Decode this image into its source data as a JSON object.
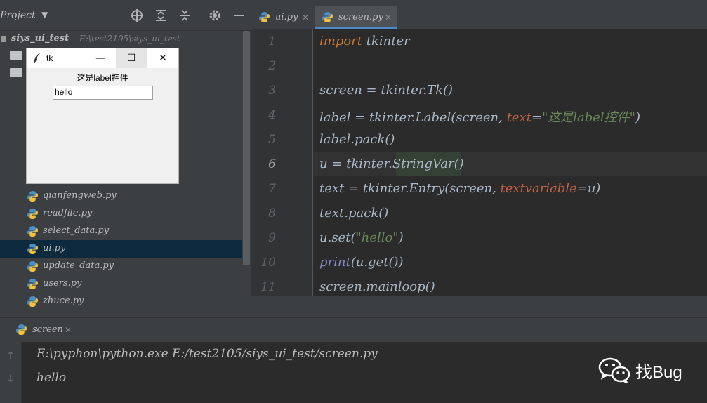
{
  "project_panel": {
    "title": "Project",
    "dropdown": "▼",
    "toolbar_icons": [
      "crosshair-icon",
      "expand-all-icon",
      "collapse-all-icon",
      "gear-icon",
      "minimize-icon"
    ],
    "root": {
      "name": "siys_ui_test",
      "path": "E:\\test2105\\siys_ui_test"
    },
    "files": [
      {
        "label": "qianfengweb.py",
        "selected": false
      },
      {
        "label": "readfile.py",
        "selected": false
      },
      {
        "label": "select_data.py",
        "selected": false
      },
      {
        "label": "ui.py",
        "selected": true
      },
      {
        "label": "update_data.py",
        "selected": false
      },
      {
        "label": "users.py",
        "selected": false
      },
      {
        "label": "zhuce.py",
        "selected": false
      }
    ]
  },
  "tk_window": {
    "title": "tk",
    "minimize": "—",
    "maximize": "☐",
    "close": "✕",
    "label_text": "这是label控件",
    "entry_value": "hello"
  },
  "editor": {
    "tabs": [
      {
        "label": "ui.py",
        "close": "✕",
        "active": false
      },
      {
        "label": "screen.py",
        "close": "✕",
        "active": true
      }
    ],
    "line_numbers": [
      "1",
      "2",
      "3",
      "4",
      "5",
      "6",
      "7",
      "8",
      "9",
      "10",
      "11"
    ],
    "current_line": "6",
    "code": {
      "l1_kw": "import",
      "l1_rest": " tkinter",
      "l3": "screen = tkinter.Tk()",
      "l4_a": "label = tkinter.Label(screen, ",
      "l4_param": "text",
      "l4_eq": "=",
      "l4_str": "\"这是label控件\"",
      "l4_end": ")",
      "l5": "label.pack()",
      "l6": "u = tkinter.StringVar()",
      "l7_a": "text = tkinter.Entry(screen, ",
      "l7_param": "textvariable",
      "l7_end": "=u)",
      "l8": "text.pack()",
      "l9_a": "u.set(",
      "l9_str": "\"hello\"",
      "l9_end": ")",
      "l10_builtin": "print",
      "l10_rest": "(u.get())",
      "l11": "screen.mainloop()"
    }
  },
  "run_panel": {
    "tab_label": "screen",
    "tab_close": "✕",
    "up_arrow": "↑",
    "down_arrow": "↓",
    "console": [
      "E:\\pyphon\\python.exe E:/test2105/siys_ui_test/screen.py",
      "hello"
    ]
  },
  "watermark": {
    "text": "找Bug",
    "icon": "wechat-icon"
  },
  "colors": {
    "keyword": "#cc7832",
    "string": "#6a8759",
    "param": "#c06040",
    "builtin": "#8888c6",
    "selection": "#0d293e",
    "tab_accent": "#4a88c7"
  }
}
